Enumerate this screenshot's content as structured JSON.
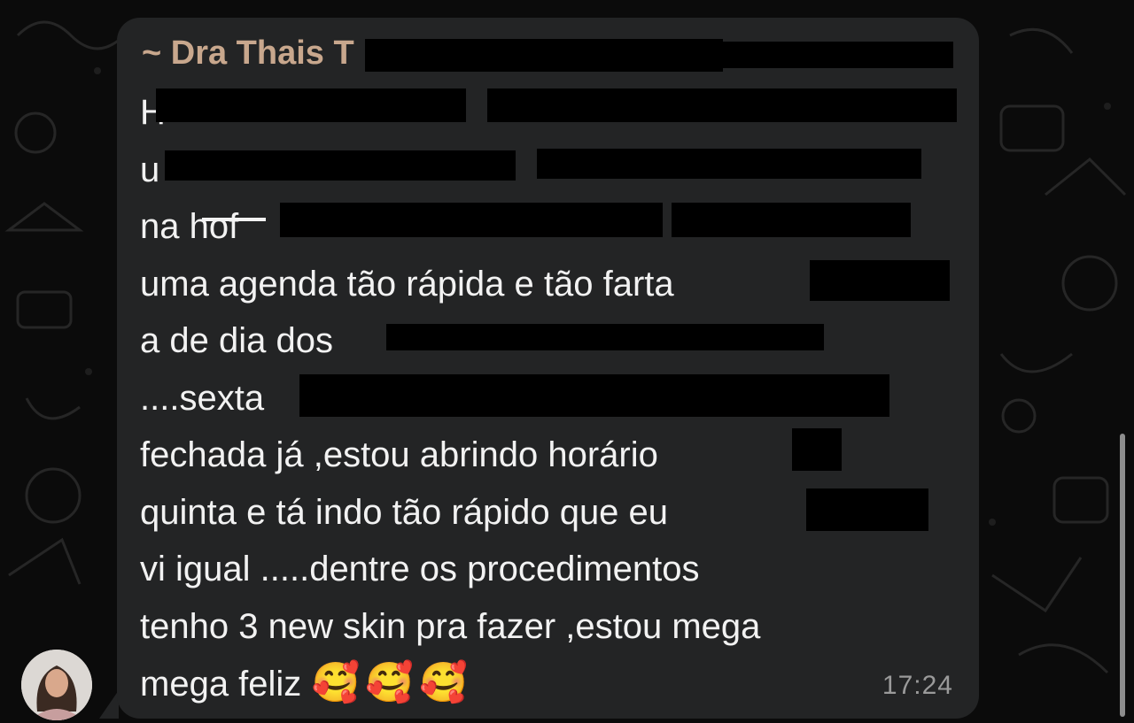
{
  "chat": {
    "sender_name": "~ Dra Thais T",
    "message_lines": [
      "H",
      "u",
      "na hof",
      "uma agenda tão rápida e tão farta",
      "a de dia dos",
      "....sexta",
      "fechada já ,estou abrindo horário",
      "quinta e tá indo tão rápido que eu",
      "vi igual .....dentre os procedimentos",
      "tenho 3 new skin pra fazer ,estou mega",
      "mega feliz"
    ],
    "emojis": "🥰🥰🥰",
    "timestamp": "17:24"
  },
  "colors": {
    "background": "#0b0b0b",
    "bubble": "#232425",
    "sender_name": "#c8a78d",
    "message_text": "#f2f2f2",
    "timestamp": "#9a9a9a"
  },
  "icons": {
    "avatar": "avatar-photo",
    "wallpaper": "doodle-pattern"
  }
}
